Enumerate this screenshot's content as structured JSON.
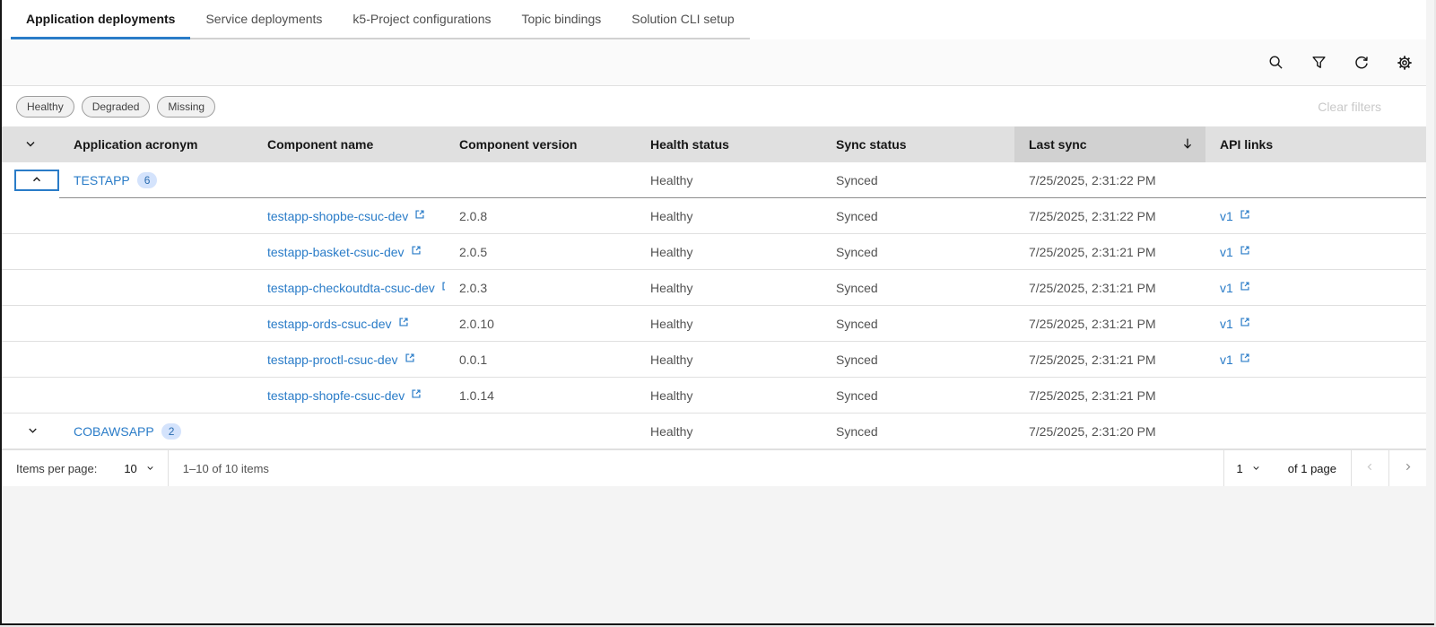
{
  "tabs": [
    {
      "label": "Application deployments",
      "active": true
    },
    {
      "label": "Service deployments",
      "active": false
    },
    {
      "label": "k5-Project configurations",
      "active": false
    },
    {
      "label": "Topic bindings",
      "active": false
    },
    {
      "label": "Solution CLI setup",
      "active": false
    }
  ],
  "toolbar": {
    "icons": [
      "search-icon",
      "filter-icon",
      "refresh-icon",
      "settings-icon"
    ]
  },
  "filters": {
    "tags": [
      "Healthy",
      "Degraded",
      "Missing"
    ],
    "clear_label": "Clear filters"
  },
  "colors": {
    "accent_blue": "#2a7cc8",
    "header_bg": "#e0e0e0",
    "sorted_header_bg": "#d1d1d1",
    "badge_bg": "#d4e3fc",
    "badge_text": "#2a6db0"
  },
  "table": {
    "headers": {
      "application_acronym": "Application acronym",
      "component_name": "Component name",
      "component_version": "Component version",
      "health_status": "Health status",
      "sync_status": "Sync status",
      "last_sync": "Last sync",
      "api_links": "API links"
    },
    "sort": {
      "column": "Last sync",
      "direction": "descending"
    },
    "rows": [
      {
        "type": "application",
        "acronym": "TESTAPP",
        "count": "6",
        "expanded": true,
        "health": "Healthy",
        "sync": "Synced",
        "last_sync": "7/25/2025, 2:31:22 PM"
      },
      {
        "type": "component",
        "name": "testapp-shopbe-csuc-dev",
        "version": "2.0.8",
        "health": "Healthy",
        "sync": "Synced",
        "last_sync": "7/25/2025, 2:31:22 PM",
        "api_link": "v1"
      },
      {
        "type": "component",
        "name": "testapp-basket-csuc-dev",
        "version": "2.0.5",
        "health": "Healthy",
        "sync": "Synced",
        "last_sync": "7/25/2025, 2:31:21 PM",
        "api_link": "v1"
      },
      {
        "type": "component",
        "name": "testapp-checkoutdta-csuc-dev",
        "version": "2.0.3",
        "health": "Healthy",
        "sync": "Synced",
        "last_sync": "7/25/2025, 2:31:21 PM",
        "api_link": "v1"
      },
      {
        "type": "component",
        "name": "testapp-ords-csuc-dev",
        "version": "2.0.10",
        "health": "Healthy",
        "sync": "Synced",
        "last_sync": "7/25/2025, 2:31:21 PM",
        "api_link": "v1"
      },
      {
        "type": "component",
        "name": "testapp-proctl-csuc-dev",
        "version": "0.0.1",
        "health": "Healthy",
        "sync": "Synced",
        "last_sync": "7/25/2025, 2:31:21 PM",
        "api_link": "v1"
      },
      {
        "type": "component",
        "name": "testapp-shopfe-csuc-dev",
        "version": "1.0.14",
        "health": "Healthy",
        "sync": "Synced",
        "last_sync": "7/25/2025, 2:31:21 PM"
      },
      {
        "type": "application",
        "acronym": "COBAWSAPP",
        "count": "2",
        "expanded": false,
        "health": "Healthy",
        "sync": "Synced",
        "last_sync": "7/25/2025, 2:31:20 PM"
      }
    ]
  },
  "pagination": {
    "items_per_page_label": "Items per page:",
    "items_per_page_value": "10",
    "range_text": "1–10 of 10 items",
    "page_value": "1",
    "page_text": "of 1 page"
  }
}
